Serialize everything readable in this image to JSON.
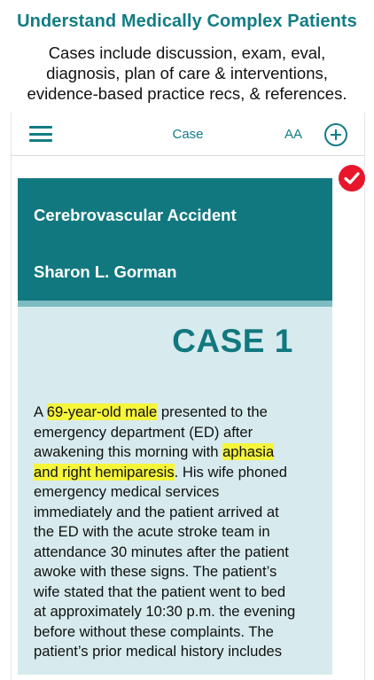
{
  "promo": {
    "title": "Understand Medically Complex Patients",
    "subtitle_lines": [
      "Cases include discussion, exam, eval,",
      "diagnosis, plan of care & interventions,",
      "evidence-based practice recs, & references."
    ]
  },
  "navbar": {
    "menu_icon": "hamburger-menu-icon",
    "title": "Case",
    "font_size_label": "AA",
    "add_icon": "plus-circle-icon"
  },
  "badge": {
    "icon": "checkmark-icon",
    "color": "#e8162b"
  },
  "case": {
    "topic": "Cerebrovascular Accident",
    "author": "Sharon L. Gorman",
    "number_label": "CASE 1",
    "body": [
      [
        {
          "t": "A "
        },
        {
          "t": "69-year-old male",
          "hl": true
        },
        {
          "t": " presented to the"
        }
      ],
      [
        {
          "t": "emergency department (ED) after"
        }
      ],
      [
        {
          "t": "awakening this morning with "
        },
        {
          "t": "aphasia",
          "hl": true
        }
      ],
      [
        {
          "t": "and right hemiparesis",
          "hl": true
        },
        {
          "t": ". His wife phoned"
        }
      ],
      [
        {
          "t": "emergency medical services"
        }
      ],
      [
        {
          "t": "immediately and the patient arrived at"
        }
      ],
      [
        {
          "t": "the ED with the acute stroke team in"
        }
      ],
      [
        {
          "t": "attendance 30 minutes after the patient"
        }
      ],
      [
        {
          "t": "awoke with these signs. The patient’s"
        }
      ],
      [
        {
          "t": "wife stated that the patient went to bed"
        }
      ],
      [
        {
          "t": "at approximately 10:30 p.m. the evening"
        }
      ],
      [
        {
          "t": "before without these complaints. The"
        }
      ],
      [
        {
          "t": "patient’s prior medical history includes"
        }
      ]
    ]
  },
  "colors": {
    "accent": "#127d84",
    "header_band": "#127880",
    "page_background": "#d7ebee",
    "highlight": "#f5f53a"
  }
}
